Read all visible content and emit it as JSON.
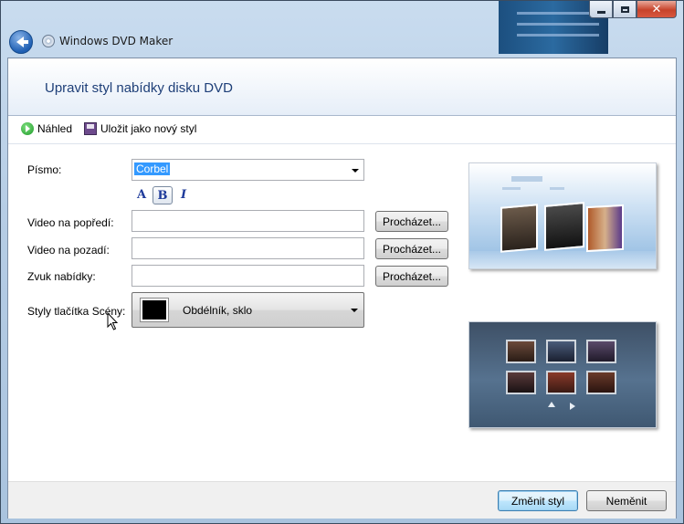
{
  "window": {
    "app_title": "Windows DVD Maker",
    "icons": {
      "back": "back-arrow-icon",
      "app": "dvd-disc-icon",
      "minimize": "minimize-icon",
      "maximize": "maximize-icon",
      "close": "close-icon"
    }
  },
  "header": {
    "title": "Upravit styl nabídky disku DVD"
  },
  "toolbar": {
    "preview_label": "Náhled",
    "save_style_label": "Uložit jako nový styl"
  },
  "form": {
    "font_label": "Písmo:",
    "font_value": "Corbel",
    "format_buttons": [
      "A",
      "B",
      "I"
    ],
    "foreground_video_label": "Video na popředí:",
    "foreground_video_value": "",
    "background_video_label": "Video na pozadí:",
    "background_video_value": "",
    "menu_audio_label": "Zvuk nabídky:",
    "menu_audio_value": "",
    "browse_label": "Procházet...",
    "scene_button_style_label": "Styly tlačítka Scény:",
    "scene_button_style_value": "Obdélník, sklo"
  },
  "footer": {
    "change_style_label": "Změnit styl",
    "cancel_label": "Neměnit"
  },
  "colors": {
    "header_title": "#1e3f78",
    "selection": "#3399ff",
    "format_icon": "#1e3a9a"
  }
}
